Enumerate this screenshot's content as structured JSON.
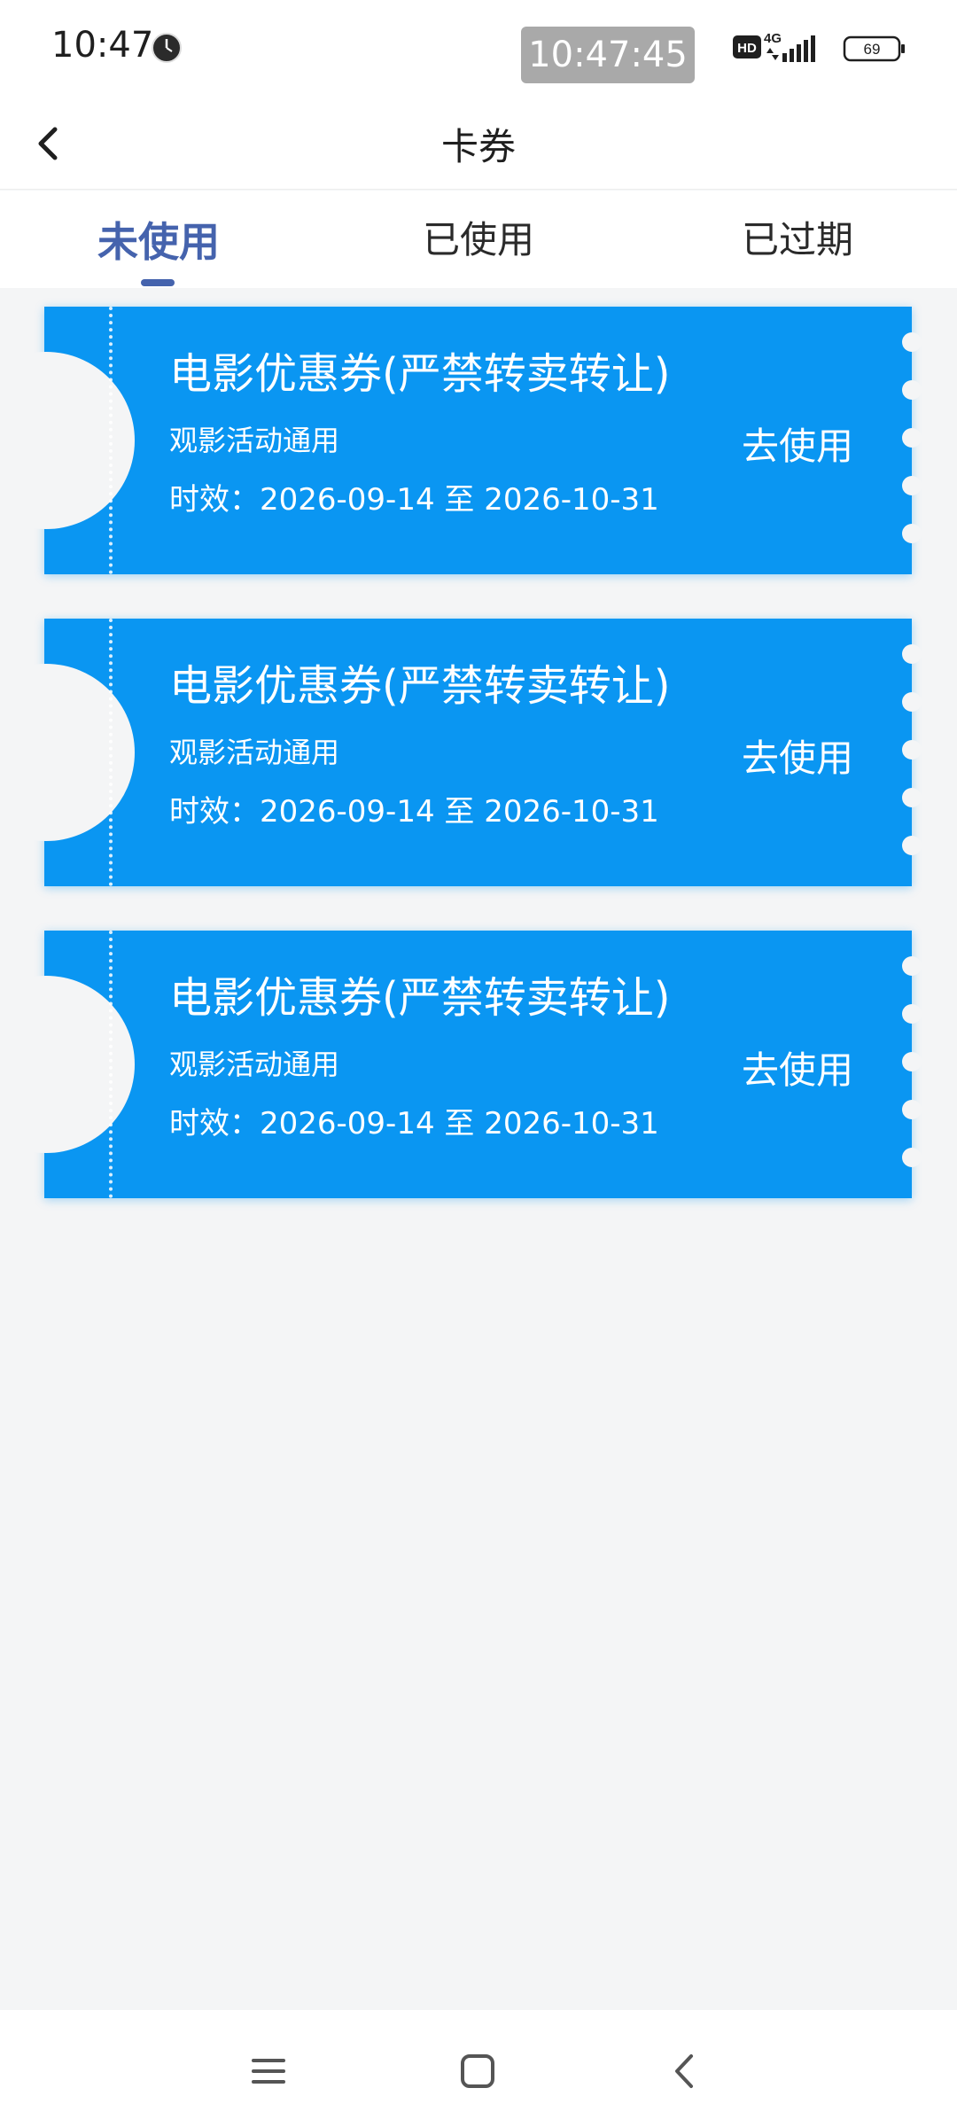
{
  "status_bar": {
    "time": "10:47",
    "floating_clock": "10:47:45",
    "hd_label": "HD",
    "network_label": "4G",
    "battery": "69"
  },
  "nav": {
    "title": "卡券"
  },
  "tabs": [
    {
      "label": "未使用",
      "active": true
    },
    {
      "label": "已使用",
      "active": false
    },
    {
      "label": "已过期",
      "active": false
    }
  ],
  "coupons": [
    {
      "title": "电影优惠券(严禁转卖转让)",
      "scope": "观影活动通用",
      "validity": "时效：2026-09-14 至 2026-10-31",
      "action": "去使用"
    },
    {
      "title": "电影优惠券(严禁转卖转让)",
      "scope": "观影活动通用",
      "validity": "时效：2026-09-14 至 2026-10-31",
      "action": "去使用"
    },
    {
      "title": "电影优惠券(严禁转卖转让)",
      "scope": "观影活动通用",
      "validity": "时效：2026-09-14 至 2026-10-31",
      "action": "去使用"
    }
  ],
  "colors": {
    "coupon_bg": "#0a96f2",
    "active_tab": "#4563ad",
    "page_bg": "#f4f5f6"
  },
  "icons": {
    "back": "chevron-left-icon",
    "menu": "menu-icon",
    "home": "home-square-icon",
    "system_back": "system-back-icon"
  }
}
